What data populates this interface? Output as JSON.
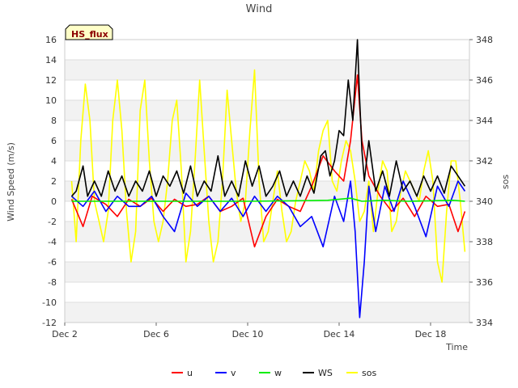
{
  "chart_data": {
    "type": "line",
    "title": "Wind",
    "badge": "HS_flux",
    "xlabel": "Time",
    "ylabel": "Wind Speed (m/s)",
    "y2label": "sos",
    "x_range_days": [
      2,
      19.7
    ],
    "x_ticks": [
      {
        "label": "Dec 2",
        "day": 2
      },
      {
        "label": "Dec 6",
        "day": 6
      },
      {
        "label": "Dec 10",
        "day": 10
      },
      {
        "label": "Dec 14",
        "day": 14
      },
      {
        "label": "Dec 18",
        "day": 18
      }
    ],
    "ylim": [
      -12,
      16
    ],
    "y_ticks": [
      -12,
      -10,
      -8,
      -6,
      -4,
      -2,
      0,
      2,
      4,
      6,
      8,
      10,
      12,
      14,
      16
    ],
    "y2lim": [
      334,
      348
    ],
    "y2_ticks": [
      334,
      336,
      338,
      340,
      342,
      344,
      346,
      348
    ],
    "grid": true,
    "legend_position": "bottom-center",
    "series": [
      {
        "name": "u",
        "color": "#ff0000",
        "axis": "left",
        "x": [
          2.3,
          2.8,
          3.2,
          3.8,
          4.3,
          4.8,
          5.3,
          5.8,
          6.3,
          6.8,
          7.3,
          7.8,
          8.3,
          8.8,
          9.3,
          9.8,
          10.3,
          10.8,
          11.3,
          11.8,
          12.3,
          12.8,
          13.3,
          13.8,
          14.2,
          14.5,
          14.8,
          15.0,
          15.3,
          15.8,
          16.3,
          16.8,
          17.3,
          17.8,
          18.3,
          18.8,
          19.2,
          19.5
        ],
        "y": [
          0.2,
          -2.5,
          0.5,
          -0.3,
          -1.5,
          0.2,
          -0.5,
          0.3,
          -1.0,
          0.2,
          -0.5,
          -0.3,
          0.5,
          -1.0,
          -0.5,
          0.3,
          -4.5,
          -1.5,
          0.2,
          -0.5,
          -1.0,
          1.5,
          4.5,
          3.0,
          2.0,
          6.0,
          12.5,
          6.0,
          2.5,
          0.5,
          -1.0,
          0.3,
          -1.5,
          0.5,
          -0.5,
          -0.3,
          -3.0,
          -1.0
        ]
      },
      {
        "name": "v",
        "color": "#0000ff",
        "axis": "left",
        "x": [
          2.3,
          2.8,
          3.3,
          3.8,
          4.3,
          4.8,
          5.3,
          5.8,
          6.3,
          6.8,
          7.3,
          7.8,
          8.3,
          8.8,
          9.3,
          9.8,
          10.3,
          10.8,
          11.3,
          11.8,
          12.3,
          12.8,
          13.3,
          13.8,
          14.2,
          14.5,
          14.7,
          14.9,
          15.1,
          15.3,
          15.6,
          16.0,
          16.4,
          16.8,
          17.3,
          17.8,
          18.3,
          18.8,
          19.2,
          19.5
        ],
        "y": [
          0.5,
          -0.5,
          1.0,
          -1.0,
          0.5,
          -0.5,
          -0.5,
          0.5,
          -1.5,
          -3.0,
          0.8,
          -0.5,
          0.5,
          -1.0,
          0.3,
          -1.5,
          0.5,
          -1.0,
          0.5,
          -0.5,
          -2.5,
          -1.5,
          -4.5,
          0.5,
          -2.0,
          2.0,
          -3.0,
          -11.5,
          -6.0,
          1.5,
          -3.0,
          1.5,
          -1.0,
          2.0,
          -0.5,
          -3.5,
          1.5,
          -0.5,
          2.0,
          1.0
        ]
      },
      {
        "name": "w",
        "color": "#00ee00",
        "axis": "left",
        "x": [
          2.3,
          4.0,
          6.0,
          8.0,
          10.0,
          12.0,
          13.5,
          14.5,
          15.0,
          16.0,
          17.0,
          18.0,
          19.0,
          19.5
        ],
        "y": [
          0.0,
          0.0,
          0.0,
          0.0,
          0.0,
          0.05,
          0.1,
          0.3,
          0.0,
          0.1,
          0.0,
          0.05,
          0.1,
          0.0
        ]
      },
      {
        "name": "WS",
        "color": "#000000",
        "axis": "left",
        "x": [
          2.3,
          2.5,
          2.8,
          3.0,
          3.3,
          3.6,
          3.9,
          4.2,
          4.5,
          4.8,
          5.1,
          5.4,
          5.7,
          6.0,
          6.3,
          6.6,
          6.9,
          7.2,
          7.5,
          7.8,
          8.1,
          8.4,
          8.7,
          9.0,
          9.3,
          9.6,
          9.9,
          10.2,
          10.5,
          10.8,
          11.1,
          11.4,
          11.7,
          12.0,
          12.3,
          12.6,
          12.9,
          13.2,
          13.4,
          13.6,
          13.8,
          14.0,
          14.2,
          14.4,
          14.6,
          14.8,
          14.9,
          15.0,
          15.1,
          15.3,
          15.6,
          15.9,
          16.2,
          16.5,
          16.8,
          17.1,
          17.4,
          17.7,
          18.0,
          18.3,
          18.6,
          18.9,
          19.2,
          19.5
        ],
        "y": [
          0.5,
          1.0,
          3.5,
          0.5,
          2.0,
          0.5,
          3.0,
          1.0,
          2.5,
          0.5,
          2.0,
          1.0,
          3.0,
          0.5,
          2.5,
          1.5,
          3.0,
          0.8,
          3.5,
          0.5,
          2.0,
          1.0,
          4.5,
          0.5,
          2.0,
          0.5,
          4.0,
          1.5,
          3.5,
          0.5,
          1.5,
          3.0,
          0.5,
          2.0,
          0.5,
          2.5,
          0.8,
          4.5,
          5.0,
          2.5,
          4.0,
          7.0,
          6.5,
          12.0,
          8.0,
          16.0,
          10.0,
          5.0,
          2.0,
          6.0,
          1.0,
          3.0,
          0.5,
          4.0,
          1.0,
          2.0,
          0.5,
          2.5,
          1.0,
          2.5,
          0.8,
          3.5,
          2.5,
          1.5
        ]
      },
      {
        "name": "sos",
        "color": "#ffff00",
        "axis": "right",
        "x": [
          2.3,
          2.5,
          2.7,
          2.9,
          3.1,
          3.3,
          3.5,
          3.7,
          3.9,
          4.1,
          4.3,
          4.5,
          4.7,
          4.9,
          5.1,
          5.3,
          5.5,
          5.7,
          5.9,
          6.1,
          6.3,
          6.5,
          6.7,
          6.9,
          7.1,
          7.3,
          7.5,
          7.7,
          7.9,
          8.1,
          8.3,
          8.5,
          8.7,
          8.9,
          9.1,
          9.3,
          9.5,
          9.7,
          9.9,
          10.1,
          10.3,
          10.5,
          10.7,
          10.9,
          11.1,
          11.3,
          11.5,
          11.7,
          11.9,
          12.1,
          12.3,
          12.5,
          12.7,
          12.9,
          13.1,
          13.3,
          13.5,
          13.7,
          13.9,
          14.1,
          14.3,
          14.5,
          14.7,
          14.9,
          15.1,
          15.3,
          15.5,
          15.7,
          15.9,
          16.1,
          16.3,
          16.5,
          16.7,
          16.9,
          17.1,
          17.3,
          17.5,
          17.7,
          17.9,
          18.1,
          18.3,
          18.5,
          18.7,
          18.9,
          19.1,
          19.3,
          19.5
        ],
        "y": [
          341.0,
          338.0,
          343.0,
          345.8,
          344.0,
          340.0,
          339.0,
          338.0,
          339.5,
          344.0,
          346.0,
          343.5,
          339.5,
          337.0,
          338.5,
          344.5,
          346.0,
          342.0,
          339.0,
          338.0,
          339.0,
          341.0,
          344.0,
          345.0,
          341.5,
          337.0,
          338.5,
          342.0,
          346.0,
          342.5,
          339.0,
          337.0,
          338.0,
          341.0,
          345.5,
          343.0,
          340.5,
          339.0,
          340.0,
          343.5,
          346.5,
          341.0,
          338.0,
          338.5,
          340.0,
          341.5,
          339.5,
          338.0,
          338.5,
          340.0,
          341.0,
          342.0,
          341.5,
          340.5,
          342.5,
          343.5,
          344.0,
          341.0,
          340.5,
          342.0,
          343.0,
          342.5,
          341.0,
          339.0,
          339.5,
          341.0,
          338.5,
          340.5,
          342.0,
          341.5,
          338.5,
          339.0,
          340.5,
          341.5,
          341.0,
          340.5,
          340.0,
          341.5,
          342.5,
          341.0,
          337.0,
          336.0,
          339.5,
          342.0,
          342.0,
          340.0,
          337.5
        ]
      }
    ]
  }
}
